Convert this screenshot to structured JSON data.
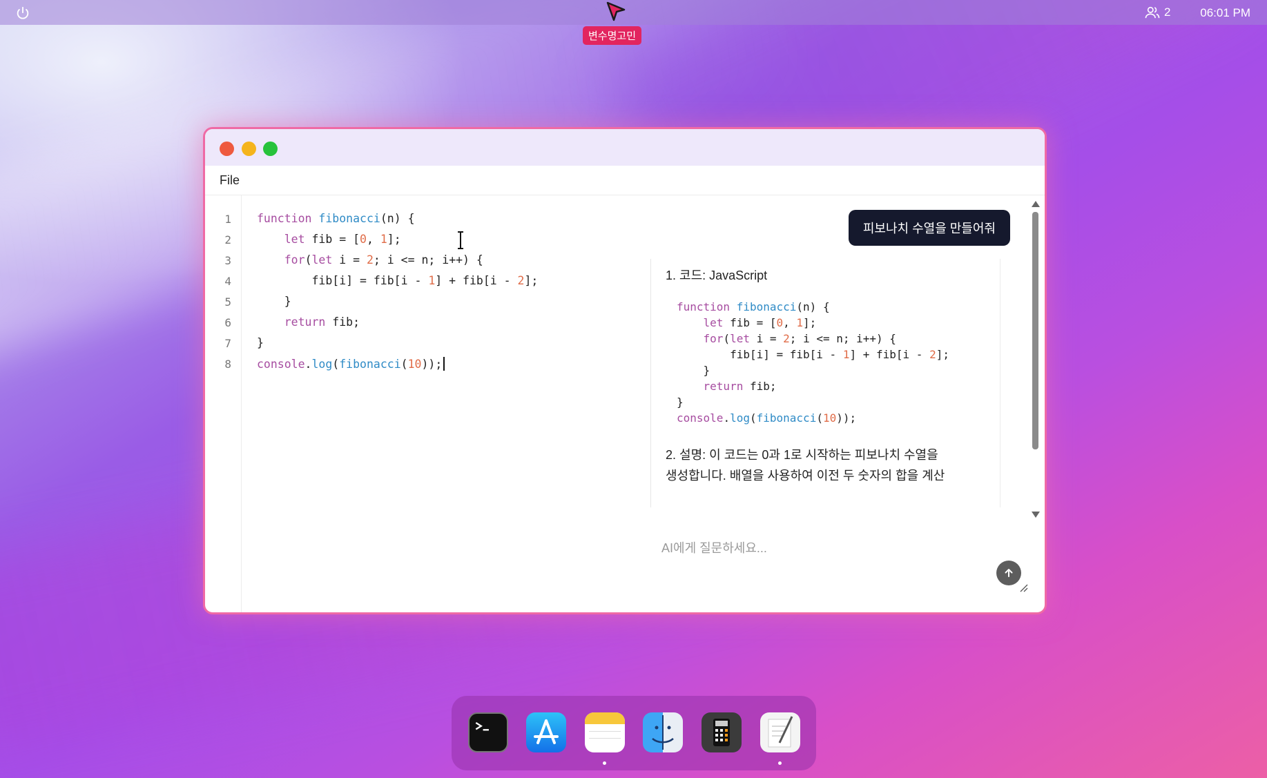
{
  "menubar": {
    "user_count": "2",
    "time": "06:01 PM"
  },
  "cursor": {
    "user_label": "변수명고민"
  },
  "window": {
    "menu_file": "File"
  },
  "editor": {
    "line_numbers": [
      "1",
      "2",
      "3",
      "4",
      "5",
      "6",
      "7",
      "8"
    ]
  },
  "chat": {
    "user_message": "피보나치 수열을 만들어줘",
    "reply_heading_1": "1. 코드: JavaScript",
    "reply_explanation_line1": "2. 설명: 이 코드는 0과 1로 시작하는 피보나치 수열을",
    "reply_explanation_line2": "생성합니다. 배열을 사용하여 이전 두 숫자의 합을 계산",
    "input_placeholder": "AI에게 질문하세요..."
  },
  "dock": {
    "apps": [
      "terminal",
      "app-store",
      "notes",
      "finder",
      "calculator",
      "text-edit"
    ]
  },
  "colors": {
    "keyword": "#a64ca0",
    "function": "#2f8bc6",
    "number": "#e06c48",
    "window_border": "#ef6aa5",
    "name_tag": "#e2255f"
  }
}
